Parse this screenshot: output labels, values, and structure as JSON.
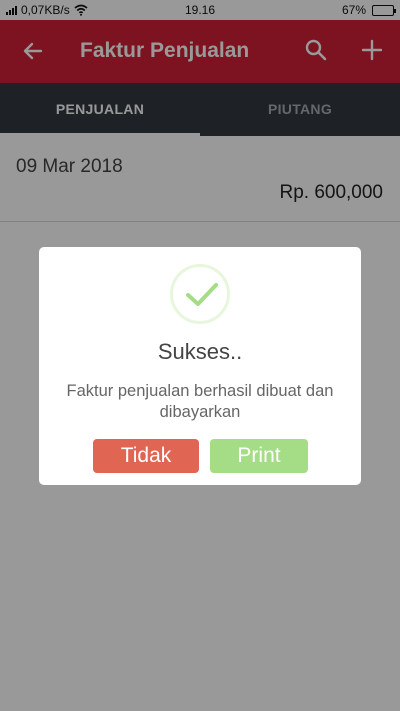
{
  "status_bar": {
    "speed": "0,07KB/s",
    "time": "19.16",
    "battery": "67%",
    "battery_level": 0.67
  },
  "app_bar": {
    "title": "Faktur Penjualan",
    "icons": [
      "back-arrow-icon",
      "search-icon",
      "add-icon"
    ]
  },
  "tabs": [
    {
      "label": "PENJUALAN",
      "active": true
    },
    {
      "label": "PIUTANG",
      "active": false
    }
  ],
  "list": [
    {
      "date": "09 Mar 2018",
      "amount": "Rp. 600,000"
    }
  ],
  "dialog": {
    "icon": "success-check-icon",
    "title": "Sukses..",
    "message": "Faktur penjualan berhasil dibuat dan dibayarkan",
    "cancel_label": "Tidak",
    "confirm_label": "Print"
  },
  "colors": {
    "primary": "#d11f36",
    "tab_bar": "#333a40",
    "cancel_button": "#e06552",
    "confirm_button": "#a5dc86",
    "success": "#a5dc86"
  }
}
